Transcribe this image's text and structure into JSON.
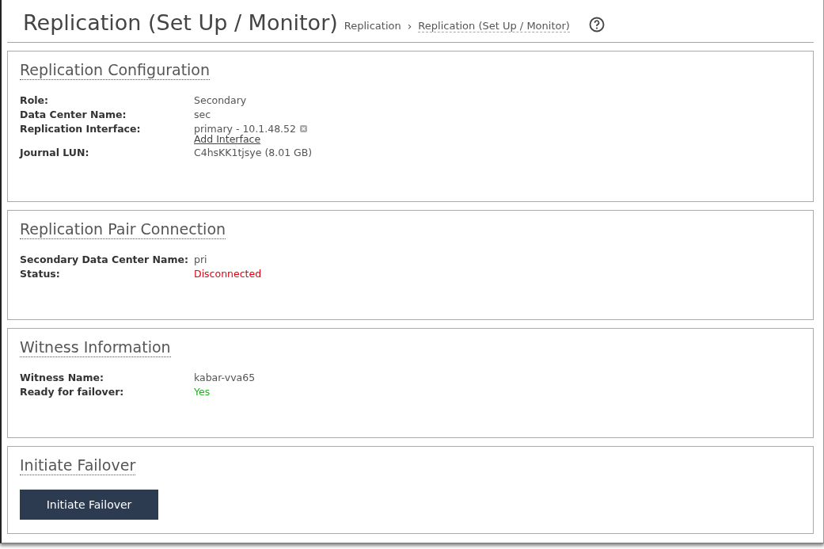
{
  "header": {
    "title": "Replication (Set Up / Monitor)",
    "breadcrumb": [
      "Replication",
      "Replication (Set Up / Monitor)"
    ],
    "breadcrumb_separator": "›"
  },
  "sections": [
    {
      "title": "Replication Configuration",
      "kind": "fields",
      "fields": [
        {
          "label": "Role:",
          "kind": "text",
          "value": "Secondary"
        },
        {
          "label": "Data Center Name:",
          "kind": "text",
          "value": "sec"
        },
        {
          "label": "Replication Interface:",
          "kind": "interface",
          "value": "primary - 10.1.48.52",
          "link": "Add Interface"
        },
        {
          "label": "Journal LUN:",
          "kind": "text",
          "value": "C4hsKK1tjsye (8.01 GB)"
        }
      ]
    },
    {
      "title": "Replication Pair Connection",
      "kind": "fields",
      "fields": [
        {
          "label": "Secondary Data Center Name:",
          "kind": "text",
          "value": "pri"
        },
        {
          "label": "Status:",
          "kind": "text",
          "value": "Disconnected",
          "color": "#e0000f"
        }
      ]
    },
    {
      "title": "Witness Information",
      "kind": "fields",
      "fields": [
        {
          "label": "Witness Name:",
          "kind": "text",
          "value": "kabar-vva65"
        },
        {
          "label": "Ready for failover:",
          "kind": "text",
          "value": "Yes",
          "color": "#1fb31f"
        }
      ]
    },
    {
      "title": "Initiate Failover",
      "kind": "action",
      "button": "Initiate Failover"
    }
  ]
}
